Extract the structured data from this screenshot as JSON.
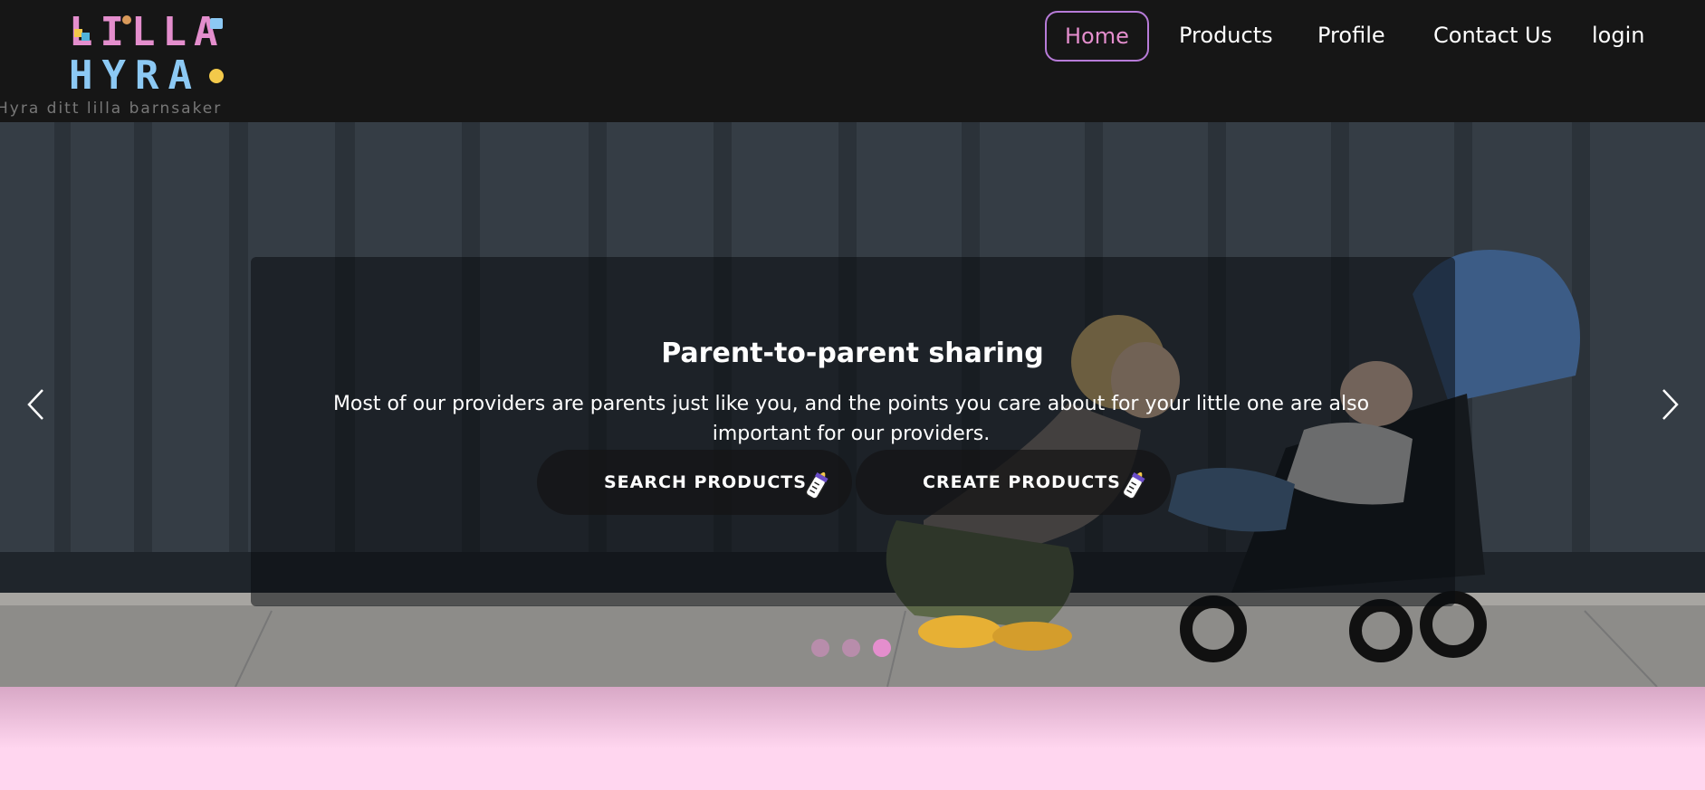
{
  "brand": {
    "logo_line1": "LILLA",
    "logo_line2": "HYRA",
    "tagline": "Hyra ditt lilla barnsaker",
    "colors": {
      "pink": "#e48ecd",
      "blue": "#8cc9f4",
      "nav_bg": "#161616",
      "accent_border": "#b77bd8",
      "page_bg": "#ffd6ef"
    }
  },
  "nav": {
    "items": [
      {
        "label": "Home",
        "active": true
      },
      {
        "label": "Products"
      },
      {
        "label": "Profile"
      },
      {
        "label": "Contact Us"
      },
      {
        "label": "login"
      }
    ]
  },
  "carousel": {
    "slide": {
      "title": "Parent-to-parent sharing",
      "text": "Most of our providers are parents just like you, and the points you care about for your little one are also important for our providers."
    },
    "buttons": {
      "search": {
        "label": "SEARCH PRODUCTS",
        "icon": "baby-bottle-icon"
      },
      "create": {
        "label": "CREATE PRODUCTS",
        "icon": "baby-bottle-icon"
      }
    },
    "prev_icon": "chevron-left-icon",
    "next_icon": "chevron-right-icon",
    "indicators": {
      "count": 3,
      "active_index": 2
    }
  }
}
